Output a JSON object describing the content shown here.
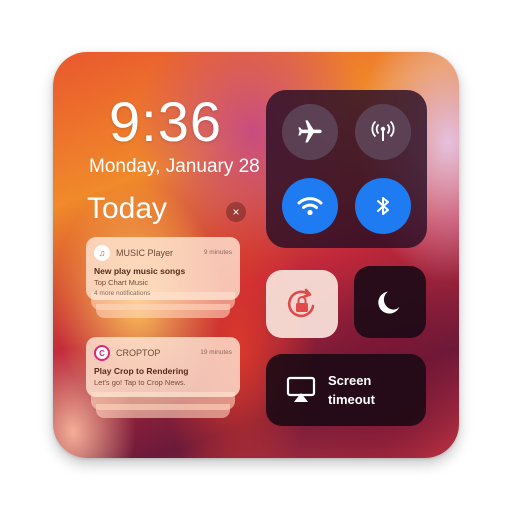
{
  "lock_screen": {
    "time": "9:36",
    "date": "Monday, January 28",
    "section_title": "Today",
    "close_label": "×"
  },
  "notifications": [
    {
      "app": "MUSIC Player",
      "time": "9 minutes",
      "title": "New play music songs",
      "subtitle": "Top Chart Music",
      "more": "4 more notifications",
      "icon": "music-note-icon"
    },
    {
      "app": "CROPTOP",
      "time": "19 minutes",
      "title": "Play Crop to Rendering",
      "subtitle": "Let's go! Tap to Crop News.",
      "icon": "croptop-icon"
    }
  ],
  "control_center": {
    "toggles": [
      {
        "name": "airplane-mode",
        "icon": "airplane-icon",
        "active": false
      },
      {
        "name": "cellular-data",
        "icon": "antenna-icon",
        "active": false
      },
      {
        "name": "wifi",
        "icon": "wifi-icon",
        "active": true
      },
      {
        "name": "bluetooth",
        "icon": "bluetooth-icon",
        "active": true
      }
    ],
    "rotation_lock": {
      "icon": "rotation-lock-icon"
    },
    "do_not_disturb": {
      "icon": "moon-icon"
    },
    "screen_timeout": {
      "label_line1": "Screen",
      "label_line2": "timeout",
      "icon": "airplay-icon"
    }
  },
  "colors": {
    "active_blue": "#1e7bf2",
    "inactive_grey": "#5a4a5a",
    "panel_dark": "#2a0e24",
    "rotation_tile": "#f3d4cc",
    "rotation_icon": "#e04a4a"
  }
}
